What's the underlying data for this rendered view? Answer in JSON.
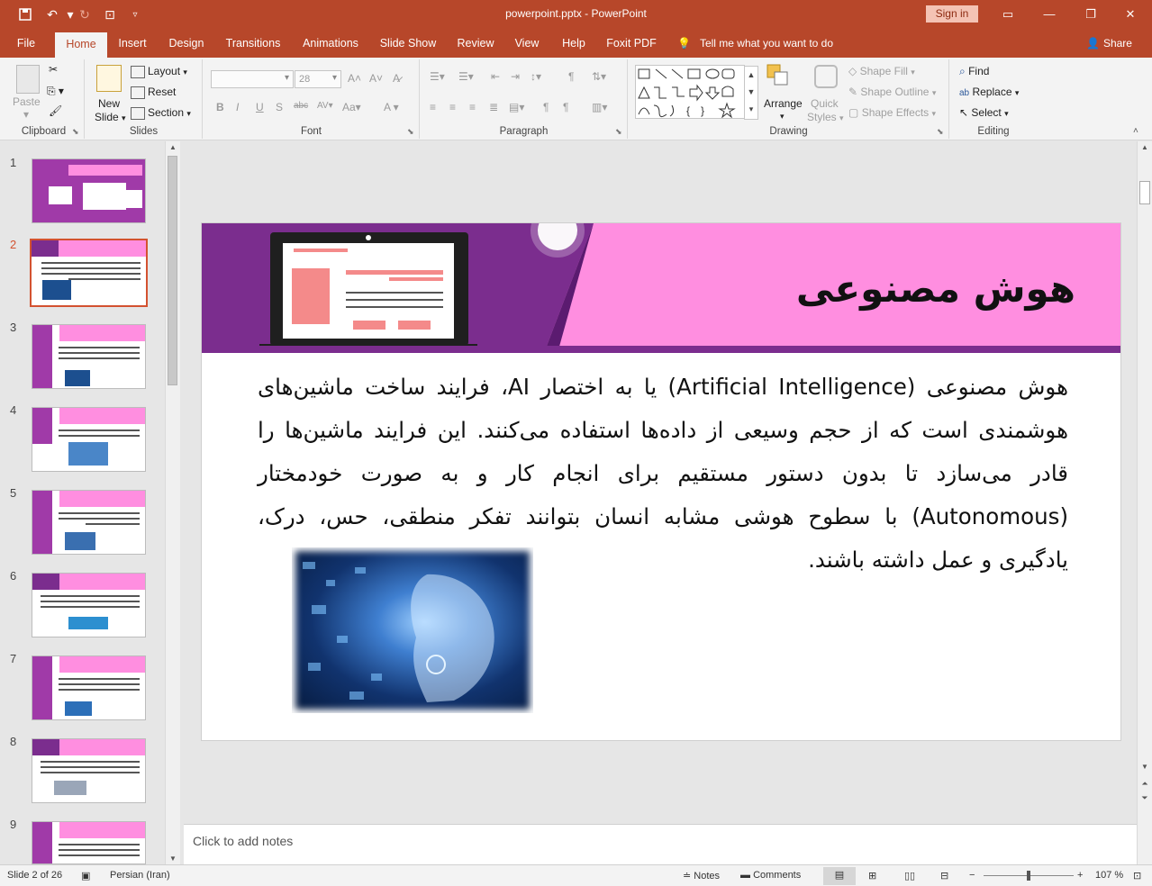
{
  "app": {
    "window_title": "powerpoint.pptx - PowerPoint",
    "sign_in": "Sign in",
    "tell_me": "Tell me what you want to do",
    "share": "Share"
  },
  "tabs": [
    "File",
    "Home",
    "Insert",
    "Design",
    "Transitions",
    "Animations",
    "Slide Show",
    "Review",
    "View",
    "Help",
    "Foxit PDF"
  ],
  "active_tab": "Home",
  "ribbon": {
    "clipboard": {
      "label": "Clipboard",
      "paste": "Paste"
    },
    "slides": {
      "label": "Slides",
      "new_slide_1": "New",
      "new_slide_2": "Slide",
      "layout": "Layout",
      "reset": "Reset",
      "section": "Section"
    },
    "font": {
      "label": "Font",
      "size": "28"
    },
    "paragraph": {
      "label": "Paragraph"
    },
    "drawing": {
      "label": "Drawing",
      "arrange": "Arrange",
      "quick_styles_1": "Quick",
      "quick_styles_2": "Styles",
      "shape_fill": "Shape Fill",
      "shape_outline": "Shape Outline",
      "shape_effects": "Shape Effects"
    },
    "editing": {
      "label": "Editing",
      "find": "Find",
      "replace": "Replace",
      "select": "Select"
    }
  },
  "thumbnails": [
    "1",
    "2",
    "3",
    "4",
    "5",
    "6",
    "7",
    "8",
    "9"
  ],
  "selected_slide": "2",
  "slide": {
    "title": "هوش مصنوعی",
    "body": "هوش مصنوعی (Artificial Intelligence) یا به اختصار AI، فرایند ساخت ماشین‌های هوشمندی است که از حجم وسیعی از داده‌ها استفاده می‌کنند. این فرایند ماشین‌ها را قادر می‌سازد تا بدون دستور مستقیم برای انجام کار و به صورت خودمختار (Autonomous) با سطوح هوشی مشابه انسان بتوانند تفکر منطقی، حس، درک، یادگیری و عمل داشته باشند."
  },
  "notes_placeholder": "Click to add notes",
  "status": {
    "slide_info": "Slide 2 of 26",
    "language": "Persian (Iran)",
    "notes": "Notes",
    "comments": "Comments",
    "zoom": "107 %"
  },
  "colors": {
    "accent": "#b7472a",
    "slide_pink": "#ff8ee0",
    "slide_purple": "#7b2d8e"
  }
}
